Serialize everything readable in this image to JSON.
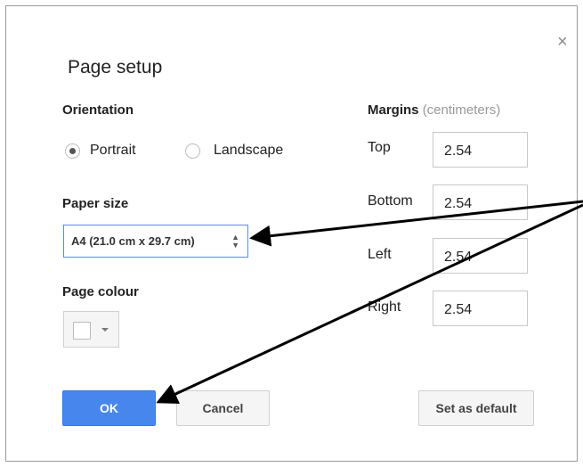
{
  "dialog": {
    "title": "Page setup",
    "close_icon": "close-icon",
    "close_label": "×"
  },
  "orientation": {
    "heading": "Orientation",
    "options": [
      {
        "label": "Portrait",
        "selected": true
      },
      {
        "label": "Landscape",
        "selected": false
      }
    ]
  },
  "paper_size": {
    "heading": "Paper size",
    "selected": "A4 (21.0 cm x 29.7 cm)",
    "arrow_up": "▲",
    "arrow_down": "▼"
  },
  "page_colour": {
    "heading": "Page colour",
    "value": "#ffffff"
  },
  "margins": {
    "heading": "Margins",
    "unit": "(centimeters)",
    "fields": [
      {
        "label": "Top",
        "value": "2.54"
      },
      {
        "label": "Bottom",
        "value": "2.54"
      },
      {
        "label": "Left",
        "value": "2.54"
      },
      {
        "label": "Right",
        "value": "2.54"
      }
    ]
  },
  "buttons": {
    "ok": "OK",
    "cancel": "Cancel",
    "set_default": "Set as default"
  },
  "annotation": {
    "arrow_color": "#000000"
  }
}
